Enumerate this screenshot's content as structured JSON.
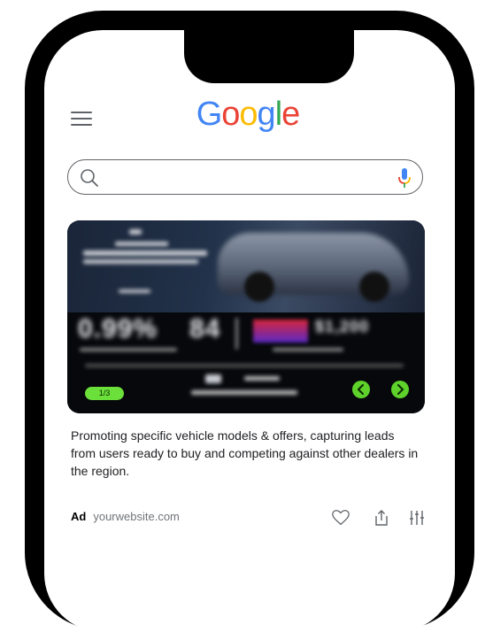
{
  "header": {
    "logo_letters": [
      {
        "ch": "G",
        "color": "#4285F4"
      },
      {
        "ch": "o",
        "color": "#EA4335"
      },
      {
        "ch": "o",
        "color": "#FBBC05"
      },
      {
        "ch": "g",
        "color": "#4285F4"
      },
      {
        "ch": "l",
        "color": "#34A853"
      },
      {
        "ch": "e",
        "color": "#EA4335"
      }
    ],
    "menu_icon": "hamburger-icon"
  },
  "search": {
    "value": "",
    "search_icon": "search-icon",
    "mic_icon": "mic-icon"
  },
  "ad_card": {
    "slide_indicator": "1/3",
    "prev_icon": "chevron-left-icon",
    "next_icon": "chevron-right-icon",
    "accent_color": "#5ED12B"
  },
  "description": "Promoting specific vehicle models & offers, capturing leads from users ready to buy and competing against other dealers in the region.",
  "ad_meta": {
    "badge": "Ad",
    "url": "yourwebsite.com",
    "like_icon": "heart-icon",
    "share_icon": "share-icon",
    "filter_icon": "sliders-icon"
  }
}
